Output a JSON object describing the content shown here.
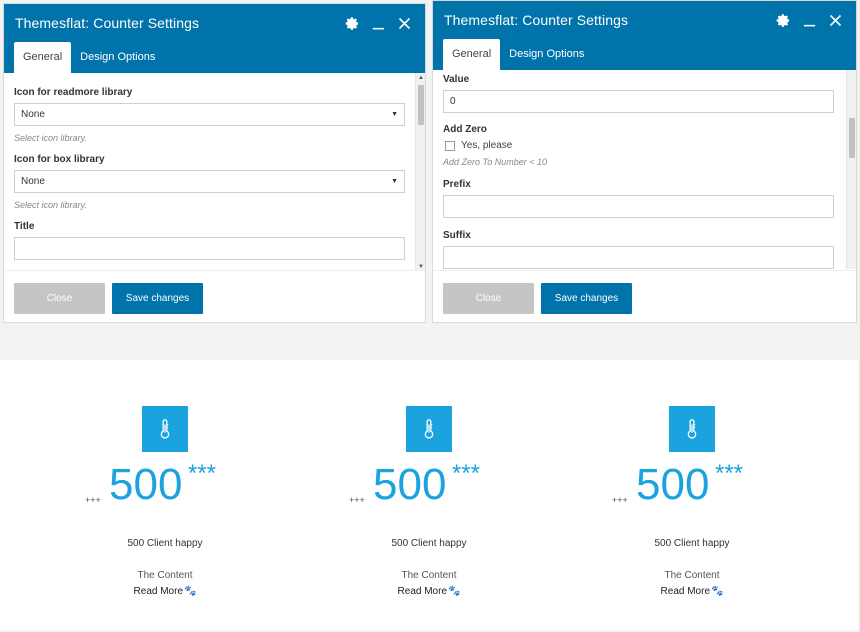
{
  "left_dialog": {
    "title": "Themesflat: Counter Settings",
    "tabs": [
      "General",
      "Design Options"
    ],
    "fields": {
      "readmore_label": "Icon for readmore library",
      "readmore_value": "None",
      "readmore_help": "Select icon library.",
      "box_label": "Icon for box library",
      "box_value": "None",
      "box_help": "Select icon library.",
      "title_label": "Title",
      "title_value": ""
    },
    "buttons": {
      "close": "Close",
      "save": "Save changes"
    }
  },
  "right_dialog": {
    "title": "Themesflat: Counter Settings",
    "tabs": [
      "General",
      "Design Options"
    ],
    "fields": {
      "value_label": "Value",
      "value_value": "0",
      "add_zero_label": "Add Zero",
      "add_zero_option": "Yes, please",
      "add_zero_help": "Add Zero To Number < 10",
      "prefix_label": "Prefix",
      "prefix_value": "",
      "suffix_label": "Suffix",
      "suffix_value": ""
    },
    "buttons": {
      "close": "Close",
      "save": "Save changes"
    }
  },
  "counters": [
    {
      "prefix": "+++",
      "number": "500",
      "suffix": "***",
      "caption": "500 Client happy",
      "content": "The Content",
      "readmore": "Read More",
      "icon": "thermometer-icon"
    },
    {
      "prefix": "+++",
      "number": "500",
      "suffix": "***",
      "caption": "500 Client happy",
      "content": "The Content",
      "readmore": "Read More",
      "icon": "thermometer-icon"
    },
    {
      "prefix": "+++",
      "number": "500",
      "suffix": "***",
      "caption": "500 Client happy",
      "content": "The Content",
      "readmore": "Read More",
      "icon": "thermometer-icon"
    }
  ],
  "colors": {
    "brand": "#0073aa",
    "accent": "#1aa3df",
    "close_button": "#c5c5c5"
  }
}
